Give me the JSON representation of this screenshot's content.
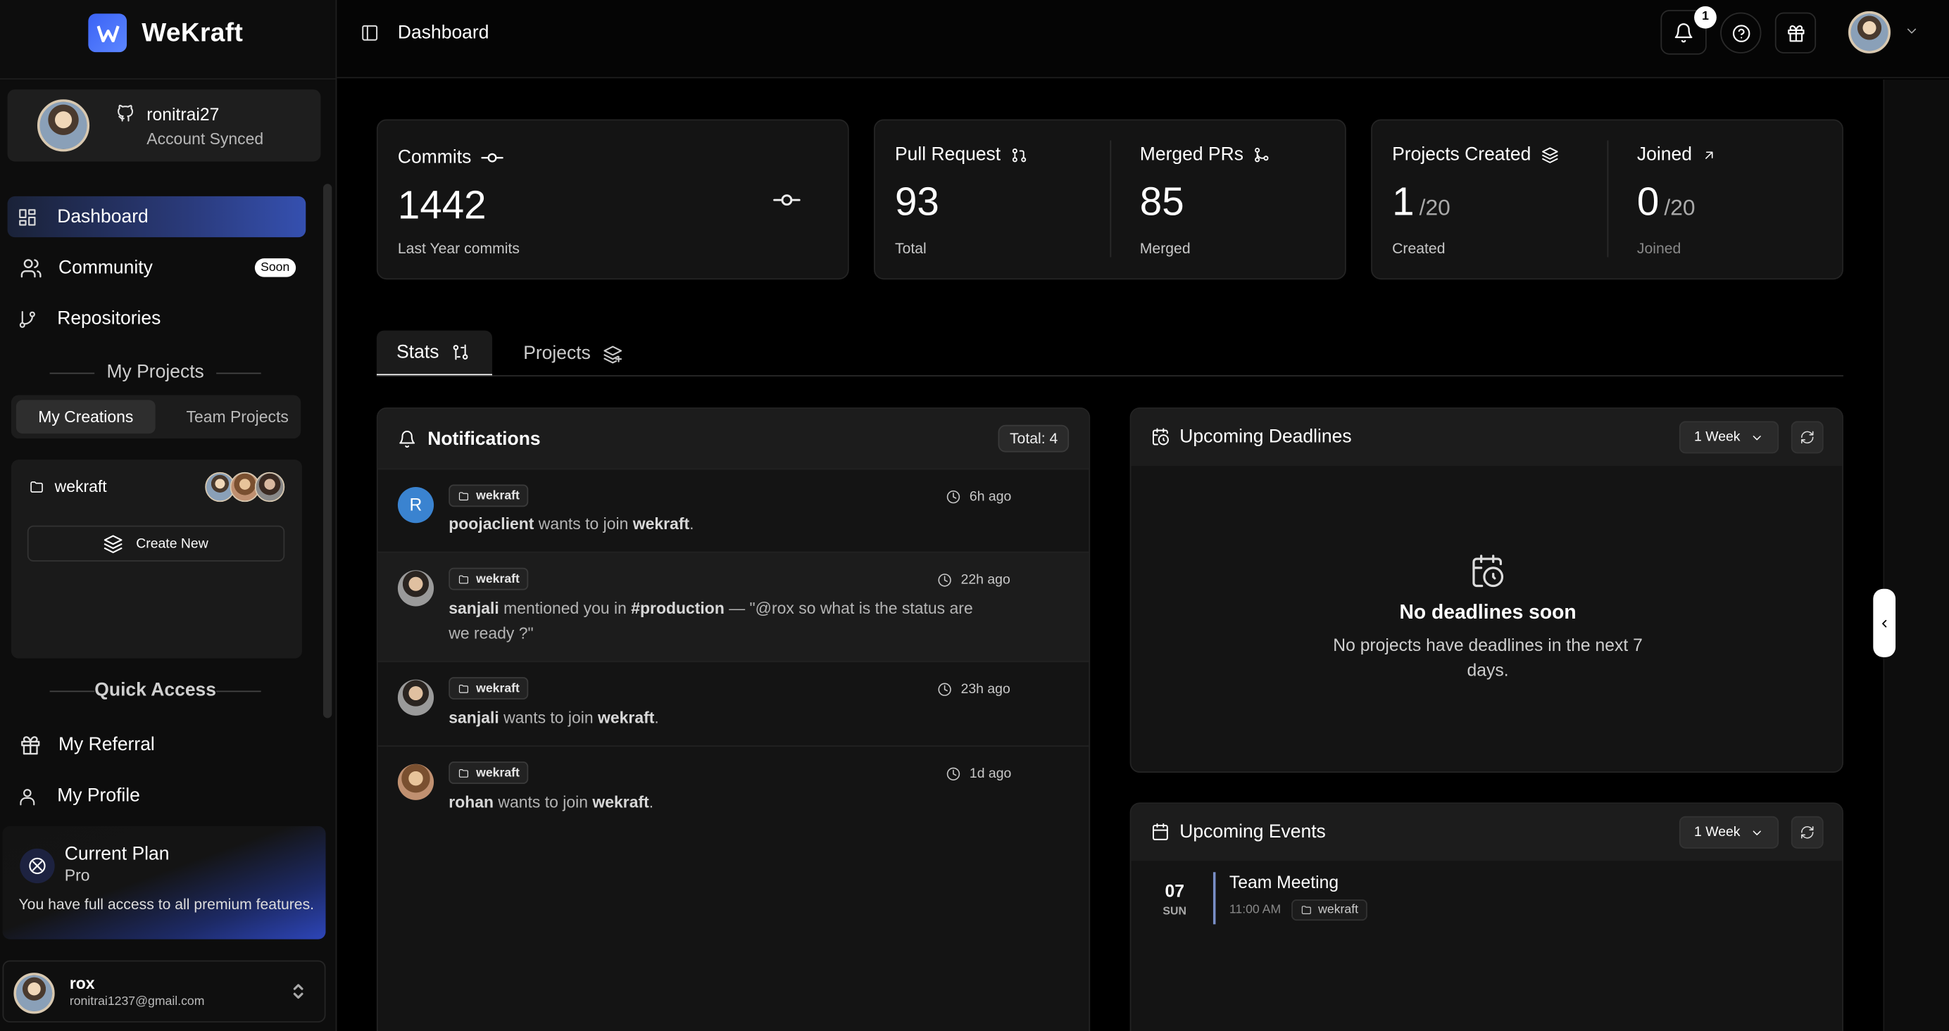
{
  "brand": {
    "name": "WeKraft"
  },
  "account": {
    "username": "ronitrai27",
    "status": "Account Synced"
  },
  "nav": [
    {
      "label": "Dashboard",
      "icon": "dashboard-grid-icon",
      "active": true
    },
    {
      "label": "Community",
      "icon": "users-icon",
      "badge": "Soon"
    },
    {
      "label": "Repositories",
      "icon": "git-branch-icon"
    }
  ],
  "my_projects": {
    "title": "My Projects",
    "tabs": [
      "My Creations",
      "Team Projects"
    ],
    "selected_tab": "My Creations",
    "project_name": "wekraft",
    "create_label": "Create New"
  },
  "quick_access": {
    "title": "Quick Access",
    "items": [
      {
        "label": "My Referral",
        "icon": "gift-icon"
      },
      {
        "label": "My Profile",
        "icon": "user-icon"
      }
    ]
  },
  "plan": {
    "title": "Current Plan",
    "tier": "Pro",
    "description": "You have full access to all premium features."
  },
  "user": {
    "name": "rox",
    "email": "ronitrai1237@gmail.com"
  },
  "topbar": {
    "title": "Dashboard",
    "notification_count": "1"
  },
  "stats": {
    "commits": {
      "label": "Commits",
      "value": "1442",
      "sub": "Last Year commits"
    },
    "pull_request": {
      "label": "Pull Request",
      "value": "93",
      "sub": "Total"
    },
    "merged_prs": {
      "label": "Merged PRs",
      "value": "85",
      "sub": "Merged"
    },
    "projects_created": {
      "label": "Projects Created",
      "value": "1",
      "max": "/20",
      "sub": "Created"
    },
    "joined": {
      "label": "Joined",
      "value": "0",
      "max": "/20",
      "sub": "Joined"
    }
  },
  "main_tabs": [
    {
      "label": "Stats",
      "active": true
    },
    {
      "label": "Projects",
      "active": false
    }
  ],
  "notifications": {
    "title": "Notifications",
    "total": "Total: 4",
    "items": [
      {
        "project": "wekraft",
        "time": "6h ago",
        "actor": "poojaclient",
        "text": " wants to join ",
        "target": "wekraft",
        "tail": ".",
        "avatar_letter": "R"
      },
      {
        "project": "wekraft",
        "time": "22h ago",
        "actor": "sanjali",
        "text": " mentioned you in ",
        "target": "#production",
        "tail": " — \"@rox so what is the status are we ready ?\""
      },
      {
        "project": "wekraft",
        "time": "23h ago",
        "actor": "sanjali",
        "text": " wants to join ",
        "target": "wekraft",
        "tail": "."
      },
      {
        "project": "wekraft",
        "time": "1d ago",
        "actor": "rohan",
        "text": " wants to join ",
        "target": "wekraft",
        "tail": "."
      }
    ]
  },
  "deadlines": {
    "title": "Upcoming Deadlines",
    "range": "1 Week",
    "empty_title": "No deadlines soon",
    "empty_sub": "No projects have deadlines in the next 7 days."
  },
  "events": {
    "title": "Upcoming Events",
    "range": "1 Week",
    "items": [
      {
        "day": "07",
        "weekday": "SUN",
        "title": "Team Meeting",
        "time": "11:00 AM",
        "project": "wekraft"
      }
    ]
  }
}
